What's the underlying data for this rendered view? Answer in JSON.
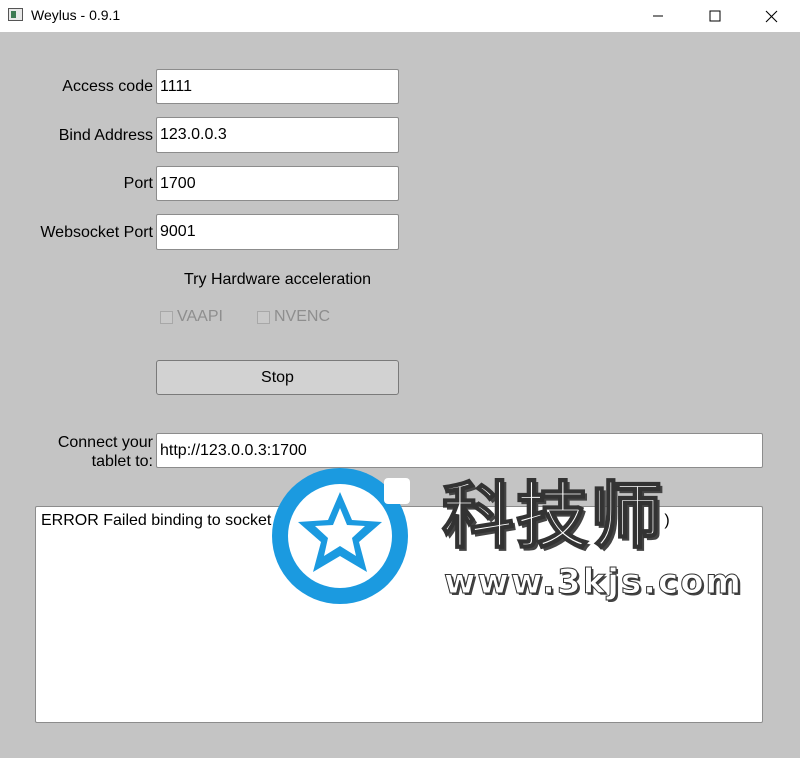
{
  "window": {
    "title": "Weylus - 0.9.1",
    "controls": [
      "minimize-icon",
      "maximize-icon",
      "close-icon"
    ]
  },
  "form": {
    "access_code": {
      "label": "Access code",
      "value": "1111"
    },
    "bind_address": {
      "label": "Bind Address",
      "value": "123.0.0.3"
    },
    "port": {
      "label": "Port",
      "value": "1700"
    },
    "websocket_port": {
      "label": "Websocket Port",
      "value": "9001"
    }
  },
  "hardware": {
    "title": "Try Hardware acceleration",
    "vaapi": {
      "label": "VAAPI",
      "checked": false,
      "enabled": false
    },
    "nvenc": {
      "label": "NVENC",
      "checked": false,
      "enabled": false
    }
  },
  "stop_button": "Stop",
  "connect": {
    "label_line1": "Connect your",
    "label_line2": "tablet to:",
    "url": "http://123.0.0.3:1700"
  },
  "log": {
    "message_start": "ERROR Failed binding to socket",
    "message_end": ")"
  },
  "watermark": {
    "brand": "科技师",
    "site": "www.3kjs.com",
    "color": "#1b9ae0"
  }
}
